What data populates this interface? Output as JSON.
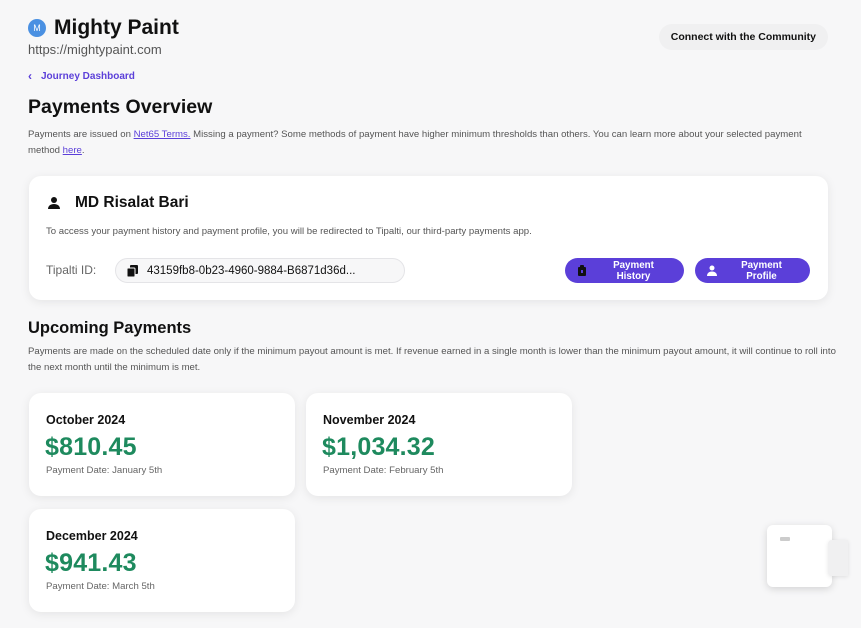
{
  "brand": {
    "logo_letter": "M",
    "name": "Mighty Paint",
    "url": "https://mightypaint.com"
  },
  "header": {
    "community_button": "Connect with the Community"
  },
  "breadcrumb": {
    "back_label": "Journey Dashboard"
  },
  "page": {
    "title": "Payments Overview",
    "intro_part1": "Payments are issued on ",
    "intro_link1": "Net65 Terms.",
    "intro_part2": " Missing a payment? Some methods of payment have higher minimum thresholds than others. You can learn more about your selected payment method ",
    "intro_link2": "here",
    "intro_part3": "."
  },
  "profile": {
    "name": "MD Risalat Bari",
    "note": "To access your payment history and payment profile, you will be redirected to Tipalti, our third-party payments app.",
    "tipalti_label": "Tipalti ID:",
    "tipalti_id": "43159fb8-0b23-4960-9884-B6871d36d...",
    "history_button": "Payment History",
    "profile_button": "Payment Profile"
  },
  "upcoming": {
    "title": "Upcoming Payments",
    "note": "Payments are made on the scheduled date only if the minimum payout amount is met. If revenue earned in a single month is lower than the minimum payout amount, it will continue to roll into the next month until the minimum is met.",
    "payments": [
      {
        "month": "October 2024",
        "amount": "$810.45",
        "date": "Payment Date: January 5th"
      },
      {
        "month": "November 2024",
        "amount": "$1,034.32",
        "date": "Payment Date: February 5th"
      },
      {
        "month": "December 2024",
        "amount": "$941.43",
        "date": "Payment Date: March 5th"
      }
    ]
  },
  "colors": {
    "accent": "#5b3fd9",
    "amount": "#1e8a5e",
    "logo": "#4a90e2"
  }
}
